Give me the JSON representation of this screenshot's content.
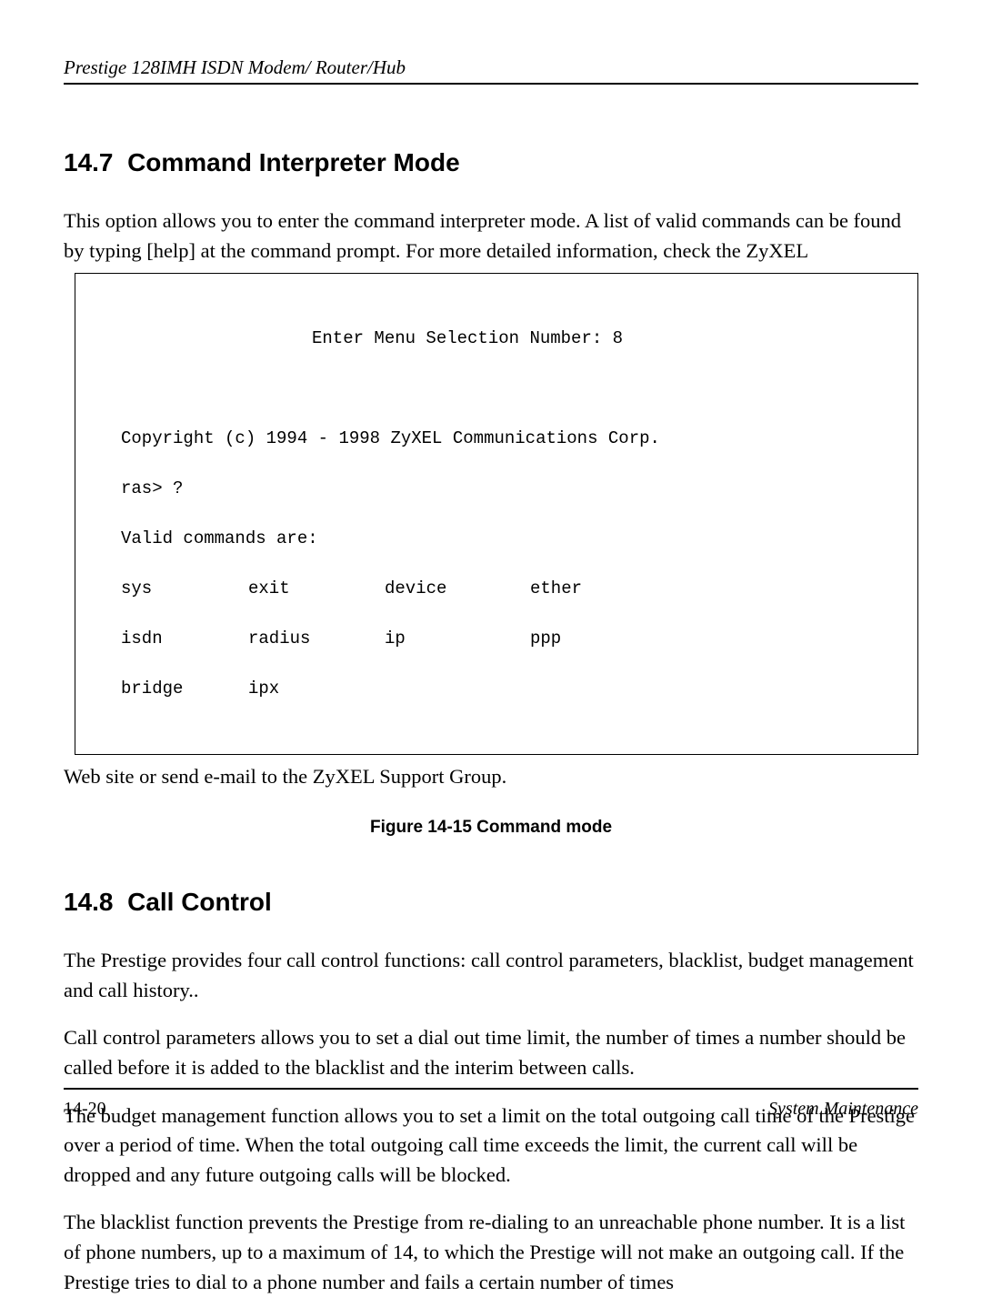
{
  "header": {
    "title": "Prestige 128IMH ISDN Modem/ Router/Hub"
  },
  "section1": {
    "number": "14.7",
    "title": "Command Interpreter Mode",
    "intro_part1": "This option allows you to enter the command interpreter mode. A list of valid commands can be found by typing [help] at the command prompt. For more detailed information, check the ZyXEL",
    "after_box": "Web site or send e-mail to the ZyXEL Support Group."
  },
  "terminal": {
    "prompt_line": "Enter Menu Selection Number: 8",
    "copyright": "Copyright (c) 1994 - 1998 ZyXEL Communications Corp.",
    "ras_prompt": "ras> ?",
    "valid_label": "Valid commands are:",
    "commands": [
      [
        "sys",
        "exit",
        "device",
        "ether"
      ],
      [
        "isdn",
        "radius",
        "ip",
        "ppp"
      ],
      [
        "bridge",
        "ipx",
        "",
        ""
      ]
    ]
  },
  "figure_caption": "Figure 14-15 Command mode",
  "section2": {
    "number": "14.8",
    "title": "Call Control",
    "para1": "The Prestige provides four call control functions: call control parameters, blacklist, budget management and call history..",
    "para2": "Call control parameters allows you to set a dial out time limit, the number of times a number should be called before it is added to the blacklist and the interim between calls.",
    "para3": "The budget management function allows you to set a limit on the total outgoing call time of the Prestige over a period of time. When the total outgoing call time exceeds the limit, the current call will be dropped and any future outgoing calls will be blocked.",
    "para4": "The blacklist function prevents the Prestige from re-dialing to an unreachable phone number. It is a list of phone numbers, up to a maximum of 14, to which the Prestige will not make an outgoing call. If the Prestige tries to dial to a phone number and fails a certain number of times"
  },
  "footer": {
    "page": "14-20",
    "section": "System Maintenance"
  }
}
